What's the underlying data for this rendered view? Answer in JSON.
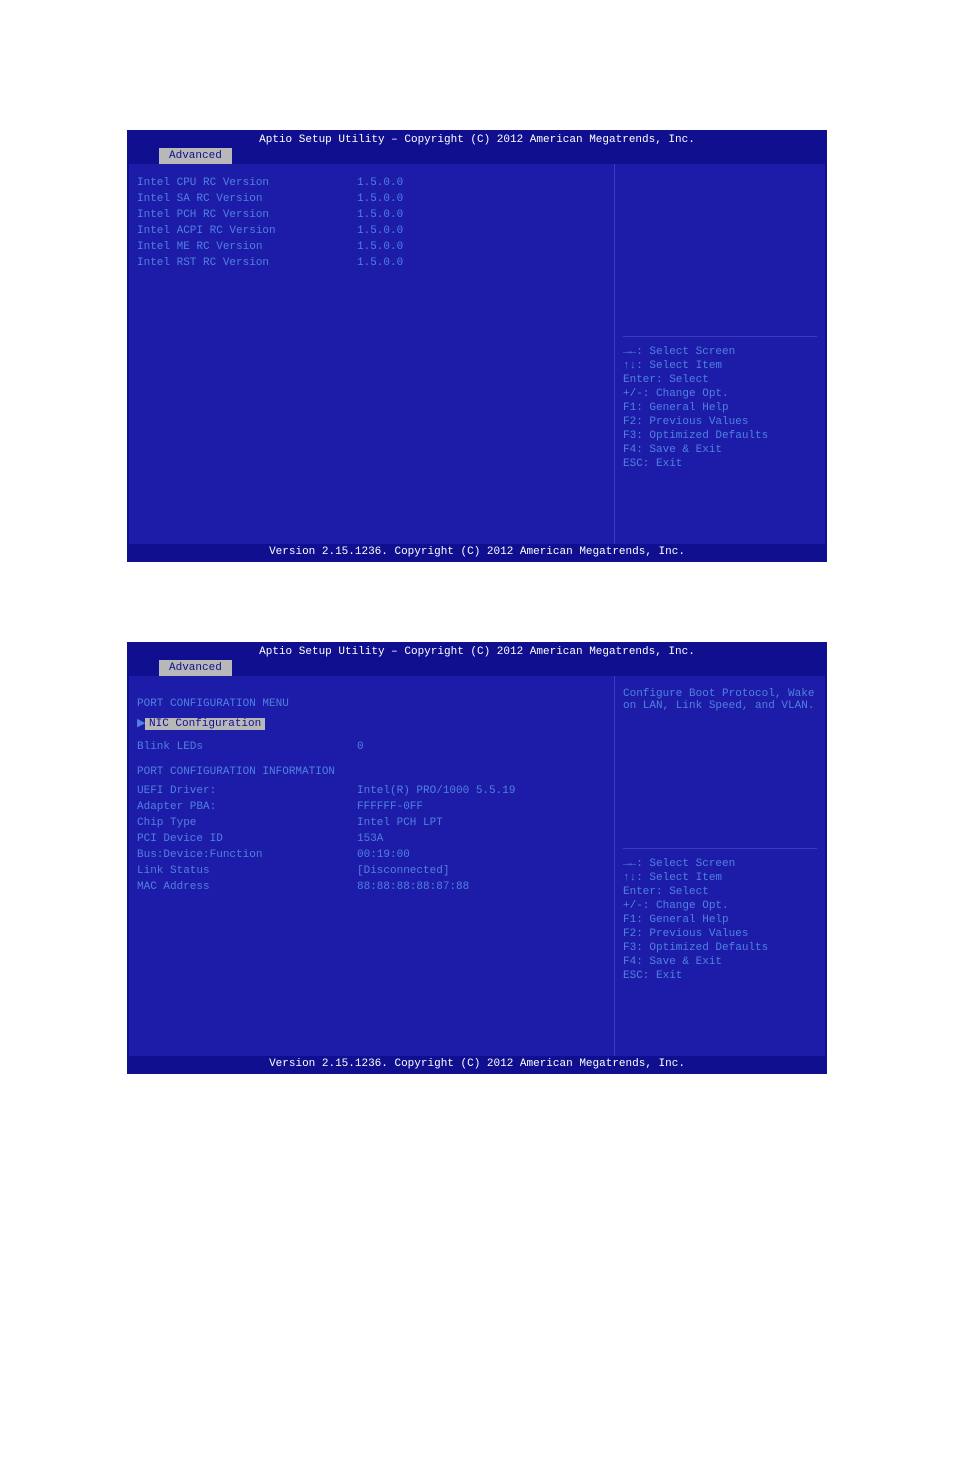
{
  "screen1": {
    "header": "Aptio Setup Utility – Copyright (C) 2012 American Megatrends, Inc.",
    "tab": "Advanced",
    "rows": [
      {
        "label": "Intel CPU RC Version",
        "value": "1.5.0.0"
      },
      {
        "label": "Intel SA RC Version",
        "value": "1.5.0.0"
      },
      {
        "label": "Intel PCH RC Version",
        "value": "1.5.0.0"
      },
      {
        "label": "Intel ACPI RC Version",
        "value": "1.5.0.0"
      },
      {
        "label": "Intel ME RC Version",
        "value": "1.5.0.0"
      },
      {
        "label": "Intel RST RC Version",
        "value": "1.5.0.0"
      }
    ],
    "help_top": "",
    "help_keys": [
      "→←: Select Screen",
      "↑↓: Select Item",
      "Enter: Select",
      "+/-: Change Opt.",
      "F1: General Help",
      "F2: Previous Values",
      "F3: Optimized Defaults",
      "F4: Save & Exit",
      "ESC: Exit"
    ],
    "footer": "Version 2.15.1236. Copyright (C) 2012 American Megatrends, Inc."
  },
  "screen2": {
    "header": "Aptio Setup Utility – Copyright (C) 2012 American Megatrends, Inc.",
    "tab": "Advanced",
    "menu_title": "PORT CONFIGURATION MENU",
    "selected_item": "NIC Configuration",
    "blink_label": "Blink LEDs",
    "blink_value": "0",
    "info_title": "PORT CONFIGURATION INFORMATION",
    "info_rows": [
      {
        "label": "UEFI Driver:",
        "value": "Intel(R) PRO/1000 5.5.19"
      },
      {
        "label": "Adapter PBA:",
        "value": "FFFFFF-0FF"
      },
      {
        "label": "Chip Type",
        "value": "Intel PCH LPT"
      },
      {
        "label": "PCI Device ID",
        "value": "153A"
      },
      {
        "label": "Bus:Device:Function",
        "value": "00:19:00"
      },
      {
        "label": "Link Status",
        "value": "[Disconnected]"
      },
      {
        "label": "MAC Address",
        "value": "88:88:88:88:87:88"
      }
    ],
    "help_top": "Configure Boot Protocol, Wake on LAN, Link Speed, and VLAN.",
    "help_keys": [
      "→←: Select Screen",
      "↑↓: Select Item",
      "Enter: Select",
      "+/-: Change Opt.",
      "F1: General Help",
      "F2: Previous Values",
      "F3: Optimized Defaults",
      "F4: Save & Exit",
      "ESC: Exit"
    ],
    "footer": "Version 2.15.1236. Copyright (C) 2012 American Megatrends, Inc."
  }
}
